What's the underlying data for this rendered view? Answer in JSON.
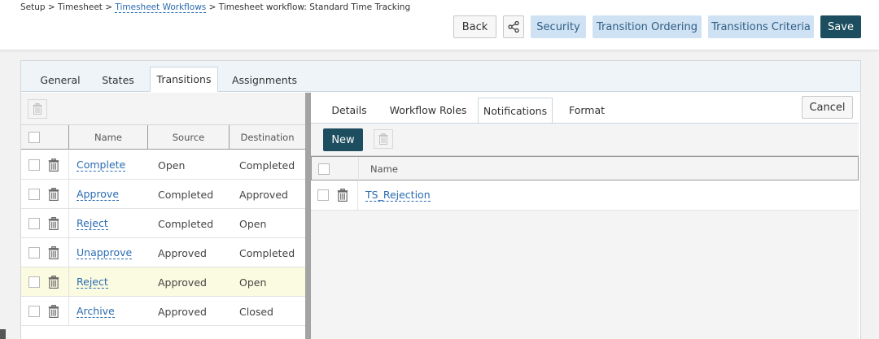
{
  "breadcrumb": {
    "part1": "Setup > Timesheet > ",
    "link": "Timesheet Workflows",
    "part2": " > Timesheet workflow: Standard Time Tracking"
  },
  "actions": {
    "back": "Back",
    "share_icon": "share-icon",
    "security": "Security",
    "transition_ordering": "Transition Ordering",
    "transitions_criteria": "Transitions Criteria",
    "save": "Save"
  },
  "tabs": [
    {
      "label": "General"
    },
    {
      "label": "States"
    },
    {
      "label": "Transitions",
      "active": true
    },
    {
      "label": "Assignments"
    }
  ],
  "transitions_grid": {
    "columns": [
      "Name",
      "Source",
      "Destination"
    ],
    "rows": [
      {
        "name": "Complete",
        "source": "Open",
        "destination": "Completed"
      },
      {
        "name": "Approve",
        "source": "Completed",
        "destination": "Approved"
      },
      {
        "name": "Reject",
        "source": "Completed",
        "destination": "Open"
      },
      {
        "name": "Unapprove",
        "source": "Approved",
        "destination": "Completed"
      },
      {
        "name": "Reject",
        "source": "Approved",
        "destination": "Open",
        "selected": true
      },
      {
        "name": "Archive",
        "source": "Approved",
        "destination": "Closed"
      }
    ]
  },
  "subtabs": [
    {
      "label": "Details"
    },
    {
      "label": "Workflow Roles"
    },
    {
      "label": "Notifications",
      "active": true
    },
    {
      "label": "Format"
    }
  ],
  "cancel": "Cancel",
  "notifications": {
    "new_button": "New",
    "columns": [
      "Name"
    ],
    "rows": [
      {
        "name": "TS_Rejection"
      }
    ]
  },
  "colors": {
    "accent_dark": "#1d4e5f",
    "accent_light": "#cfe2f3",
    "link": "#2a6bb1",
    "selected_row": "#fbfbe1"
  }
}
